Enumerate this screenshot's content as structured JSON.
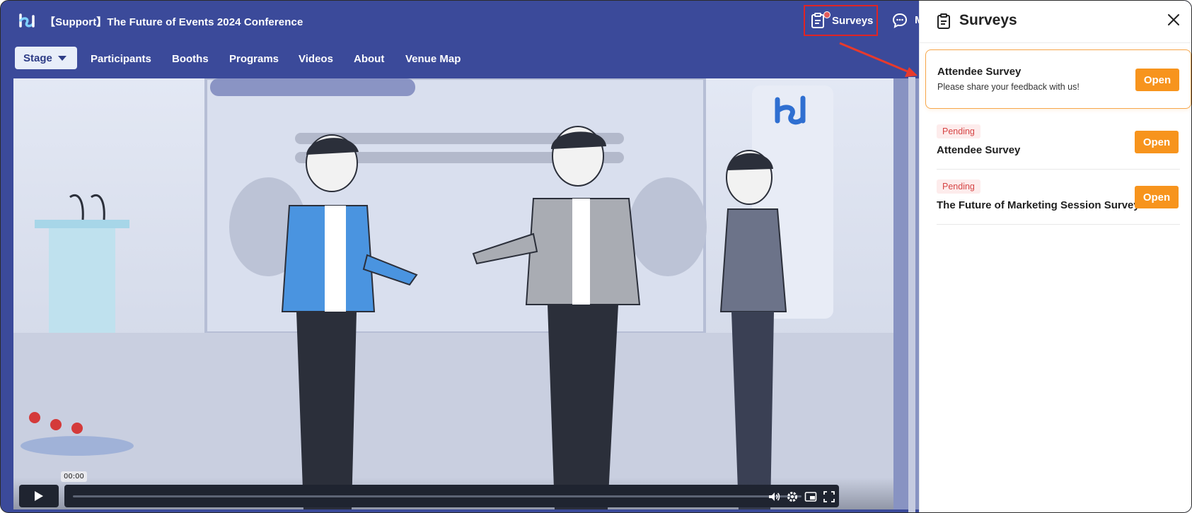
{
  "header": {
    "event_title": "【Support】The Future of Events 2024 Conference",
    "surveys_label": "Surveys",
    "messages_label_cut": "M"
  },
  "nav": {
    "items": [
      {
        "label": "Stage",
        "active": true
      },
      {
        "label": "Participants"
      },
      {
        "label": "Booths"
      },
      {
        "label": "Programs"
      },
      {
        "label": "Videos"
      },
      {
        "label": "About"
      },
      {
        "label": "Venue Map"
      }
    ]
  },
  "video": {
    "booth_brand": "EventHub",
    "current_time": "00:00",
    "progress": 0
  },
  "surveys_panel": {
    "title": "Surveys",
    "items": [
      {
        "name": "Attendee Survey",
        "description": "Please share your feedback with us!",
        "status": "",
        "button": "Open"
      },
      {
        "name": "Attendee Survey",
        "description": "",
        "status": "Pending",
        "button": "Open"
      },
      {
        "name": "The Future of Marketing Session Survey",
        "description": "",
        "status": "Pending",
        "button": "Open"
      }
    ]
  },
  "colors": {
    "header_bg": "#3b4a9a",
    "accent_orange": "#f7941d",
    "highlight_red": "#e02424",
    "pending_red": "#d64545"
  }
}
